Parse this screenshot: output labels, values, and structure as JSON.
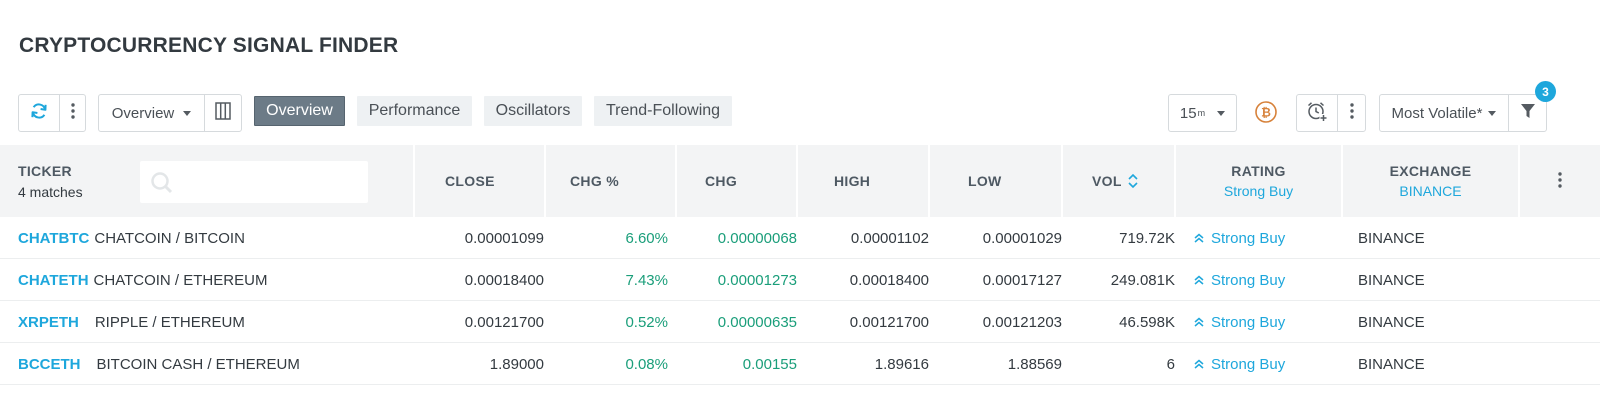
{
  "title": "CRYPTOCURRENCY SIGNAL FINDER",
  "toolbar": {
    "view_select": "Overview",
    "tabs": [
      {
        "label": "Overview",
        "active": true
      },
      {
        "label": "Performance",
        "active": false
      },
      {
        "label": "Oscillators",
        "active": false
      },
      {
        "label": "Trend-Following",
        "active": false
      }
    ],
    "interval": "15",
    "interval_sup": "m",
    "filter_preset": "Most Volatile*",
    "filter_count": "3"
  },
  "table": {
    "headers": {
      "ticker": "TICKER",
      "matches": "4 matches",
      "close": "CLOSE",
      "chg_pct": "CHG %",
      "chg": "CHG",
      "high": "HIGH",
      "low": "LOW",
      "vol": "VOL",
      "rating": "RATING",
      "rating_filter": "Strong Buy",
      "exchange": "EXCHANGE",
      "exchange_filter": "BINANCE"
    },
    "rows": [
      {
        "symbol": "CHATBTC",
        "name": "CHATCOIN / BITCOIN",
        "close": "0.00001099",
        "chg_pct": "6.60%",
        "chg": "0.00000068",
        "high": "0.00001102",
        "low": "0.00001029",
        "vol": "719.72K",
        "rating": "Strong Buy",
        "exchange": "BINANCE"
      },
      {
        "symbol": "CHATETH",
        "name": "CHATCOIN / ETHEREUM",
        "close": "0.00018400",
        "chg_pct": "7.43%",
        "chg": "0.00001273",
        "high": "0.00018400",
        "low": "0.00017127",
        "vol": "249.081K",
        "rating": "Strong Buy",
        "exchange": "BINANCE"
      },
      {
        "symbol": "XRPETH",
        "name": "RIPPLE / ETHEREUM",
        "close": "0.00121700",
        "chg_pct": "0.52%",
        "chg": "0.00000635",
        "high": "0.00121700",
        "low": "0.00121203",
        "vol": "46.598K",
        "rating": "Strong Buy",
        "exchange": "BINANCE"
      },
      {
        "symbol": "BCCETH",
        "name": "BITCOIN CASH / ETHEREUM",
        "close": "1.89000",
        "chg_pct": "0.08%",
        "chg": "0.00155",
        "high": "1.89616",
        "low": "1.88569",
        "vol": "6",
        "rating": "Strong Buy",
        "exchange": "BINANCE"
      }
    ]
  },
  "colors": {
    "accent": "#1ea7dc",
    "positive": "#1a9e7a",
    "tab_active": "#6c7b87",
    "header_bg": "#f3f4f5",
    "bitcoin": "#d7823b"
  },
  "icons": {
    "refresh": "refresh-icon",
    "more": "more-vertical-icon",
    "columns": "columns-icon",
    "bitcoin": "bitcoin-icon",
    "alert": "alarm-clock-plus-icon",
    "filter": "filter-icon",
    "search": "search-icon",
    "sort": "sort-icon",
    "rating": "double-chevron-up-icon"
  }
}
